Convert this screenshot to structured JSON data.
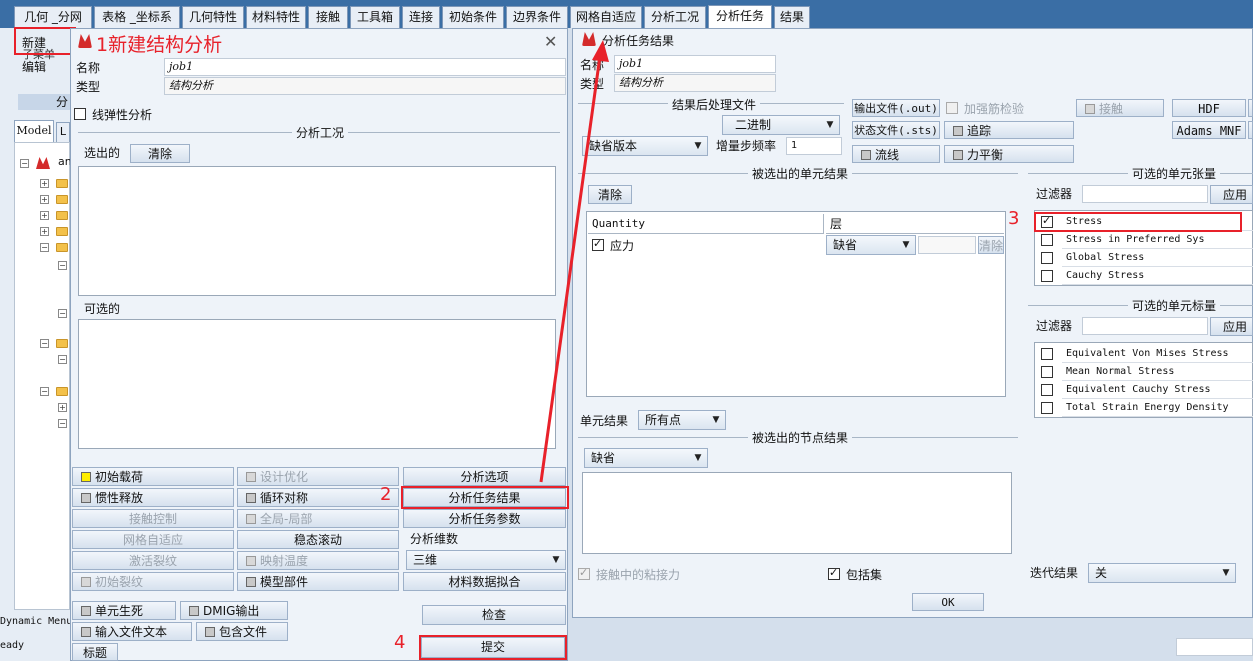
{
  "top_tabs": [
    "几何 _分网",
    "表格 _坐标系",
    "几何特性",
    "材料特性",
    "接触",
    "工具箱",
    "连接",
    "初始条件",
    "边界条件",
    "网格自适应",
    "分析工况",
    "分析任务",
    "结果"
  ],
  "left_menu": {
    "new_label": "新建",
    "sub_menu_label": "子菜单",
    "edit_label": "编辑",
    "group_label": "分",
    "model_tab": "Model",
    "second_tab": "L",
    "tree_root_label": "an",
    "dynamic_menu_label": "Dynamic Menu",
    "status_label": "eady"
  },
  "left_dialog": {
    "annotation_title": "1新建结构分析",
    "name_label": "名称",
    "name_value": "job1",
    "type_label": "类型",
    "type_value": "结构分析",
    "linear_elastic_label": "线弹性分析",
    "loadcases_group": "分析工况",
    "selected_label": "选出的",
    "clear_label": "清除",
    "available_label": "可选的",
    "grid_buttons": [
      [
        "初始载荷",
        "设计优化",
        "分析选项"
      ],
      [
        "惯性释放",
        "循环对称",
        "分析任务结果"
      ],
      [
        "接触控制",
        "全局-局部",
        "分析任务参数"
      ],
      [
        "网格自适应",
        "稳态滚动",
        "分析维数"
      ],
      [
        "激活裂纹",
        "映射温度",
        "三维"
      ],
      [
        "初始裂纹",
        "模型部件",
        "材料数据拟合"
      ]
    ],
    "element_death_label": "单元生死",
    "dmig_label": "DMIG输出",
    "input_file_text_label": "输入文件文本",
    "include_file_label": "包含文件",
    "check_label": "检查",
    "title_label": "标题",
    "submit_label": "提交",
    "step2": "2",
    "step4": "4"
  },
  "right_dialog": {
    "title": "分析任务结果",
    "name_label": "名称",
    "name_value": "job1",
    "type_label": "类型",
    "type_value": "结构分析",
    "post_file_group": "结果后处理文件",
    "binary_value": "二进制",
    "version_value": "缺省版本",
    "increment_label": "增量步频率",
    "increment_value": "1",
    "output_file_btn": "输出文件(.out)",
    "rebar_check_label": "加强筋检验",
    "contact_btn": "接触",
    "hdf_btn": "HDF",
    "status_file_btn": "状态文件(.sts)",
    "track_btn": "追踪",
    "adams_btn": "Adams MNF",
    "streamline_btn": "流线",
    "force_balance_btn": "力平衡",
    "selected_element_results_group": "被选出的单元结果",
    "clear_label": "清除",
    "table_headers": [
      "Quantity",
      "层"
    ],
    "table_row_quantity": "应力",
    "table_row_layer": "缺省",
    "table_row_clear": "清除",
    "element_results_label": "单元结果",
    "element_results_value": "所有点",
    "selected_node_results_group": "被选出的节点结果",
    "node_results_value": "缺省",
    "sticky_contact_label": "接触中的粘接力",
    "include_sets_label": "包括集",
    "iteration_results_label": "迭代结果",
    "iteration_results_value": "关",
    "ok_label": "OK",
    "tensor_group": "可选的单元张量",
    "filter_label": "过滤器",
    "apply_label": "应用",
    "tensor_items": [
      {
        "label": "Stress",
        "checked": true
      },
      {
        "label": "Stress in Preferred Sys",
        "checked": false
      },
      {
        "label": "Global Stress",
        "checked": false
      },
      {
        "label": "Cauchy Stress",
        "checked": false
      }
    ],
    "scalar_group": "可选的单元标量",
    "scalar_items": [
      {
        "label": "Equivalent Von Mises Stress",
        "checked": false
      },
      {
        "label": "Mean Normal Stress",
        "checked": false
      },
      {
        "label": "Equivalent Cauchy Stress",
        "checked": false
      },
      {
        "label": "Total Strain Energy Density",
        "checked": false
      }
    ],
    "step3": "3"
  },
  "colors": {
    "annotation_red": "#e8212a",
    "tab_strip": "#3a6ea5",
    "panel_bg": "#eef3f9"
  }
}
